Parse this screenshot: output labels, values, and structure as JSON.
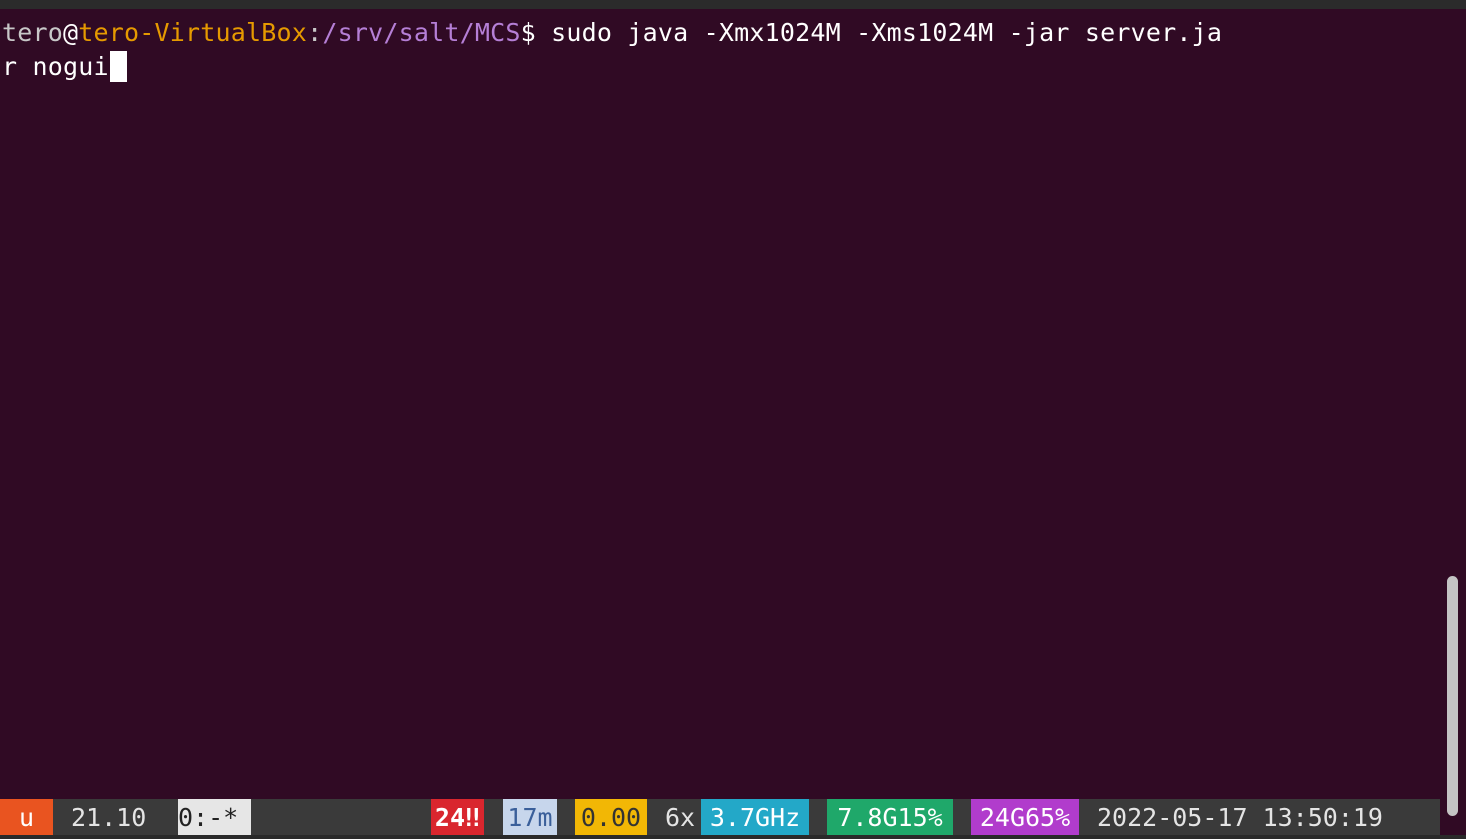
{
  "terminal": {
    "prompt_user": "tero",
    "prompt_at": "@",
    "prompt_host": "tero-VirtualBox",
    "prompt_colon": ":",
    "prompt_path": "/srv/salt/MCS",
    "prompt_dollar": "$",
    "command_line1": " sudo java -Xmx1024M -Xms1024M -jar server.ja",
    "command_line2": "r nogui"
  },
  "statusbar": {
    "distro_logo": "u",
    "version": "21.10",
    "session": "0:-*",
    "updates": "24‼",
    "uptime": "17m",
    "load": "0.00",
    "cpu_count": "6x",
    "cpu_freq": "3.7GHz",
    "mem": "7.8G15%",
    "disk": "24G65%",
    "datetime": "2022-05-17 13:50:19"
  },
  "colors": {
    "background": "#300a24",
    "host": "#e69a00",
    "path": "#b57fd6",
    "logo_bg": "#e95420",
    "updates_bg": "#d9262e",
    "uptime_bg": "#c7d6ec",
    "load_bg": "#f2b705",
    "cpu_freq_bg": "#23a8c8",
    "mem_bg": "#1fa86a",
    "disk_bg": "#b13ccc"
  }
}
